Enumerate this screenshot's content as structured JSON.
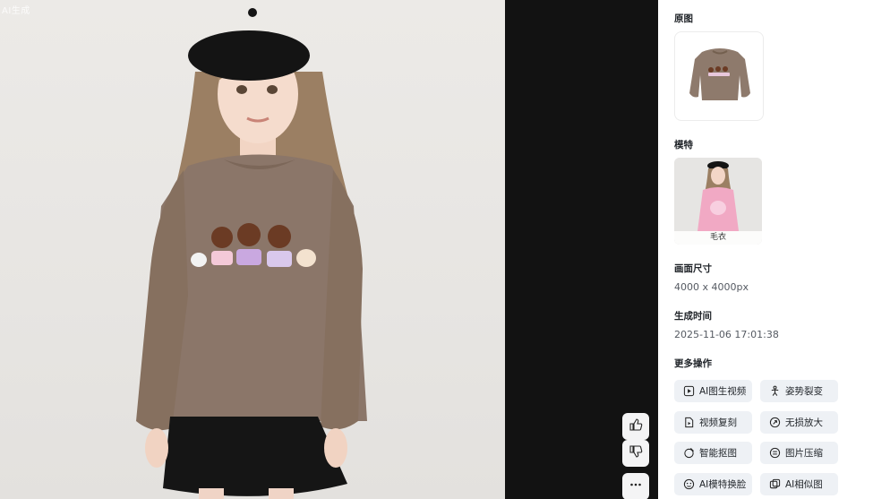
{
  "image": {
    "watermark": "AI生成"
  },
  "feedback": {
    "like_icon": "thumbs-up-icon",
    "dislike_icon": "thumbs-down-icon",
    "more_icon": "more-horizontal-icon"
  },
  "panel": {
    "original": {
      "title": "原图"
    },
    "model": {
      "title": "模特",
      "tag": "毛衣"
    },
    "size": {
      "title": "画面尺寸",
      "value": "4000 x 4000px"
    },
    "time": {
      "title": "生成时间",
      "value": "2025-11-06 17:01:38"
    },
    "more_ops": {
      "title": "更多操作",
      "buttons": [
        {
          "label": "AI图生视频",
          "icon": "image-video-icon"
        },
        {
          "label": "姿势裂变",
          "icon": "pose-icon"
        },
        {
          "label": "视频复刻",
          "icon": "video-copy-icon"
        },
        {
          "label": "无损放大",
          "icon": "upscale-icon"
        },
        {
          "label": "智能抠图",
          "icon": "cutout-icon"
        },
        {
          "label": "图片压缩",
          "icon": "compress-icon"
        },
        {
          "label": "AI模特换脸",
          "icon": "face-swap-icon"
        },
        {
          "label": "AI相似图",
          "icon": "similar-image-icon"
        }
      ]
    }
  },
  "colors": {
    "viewer_bg": "#121212",
    "button_bg": "#eef1f5",
    "sweater": "#8b7669"
  }
}
